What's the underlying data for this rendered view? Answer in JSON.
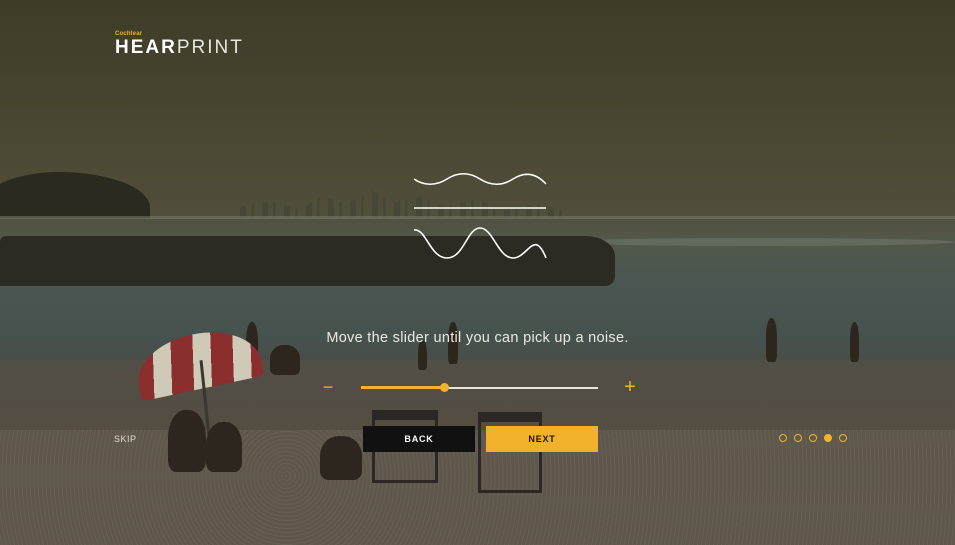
{
  "logo": {
    "brand": "Cochlear",
    "name_strong": "HEAR",
    "name_light": "PRINT"
  },
  "instruction": "Move the slider until you can pick up a noise.",
  "slider": {
    "minus_symbol": "−",
    "plus_symbol": "+",
    "value": 0.35
  },
  "skip_label": "SKIP",
  "buttons": {
    "back_label": "BACK",
    "next_label": "NEXT"
  },
  "pagination": {
    "total": 5,
    "active_index": 3
  },
  "colors": {
    "accent": "#f2b12b",
    "back_button": "#111111",
    "text": "#ffffff"
  }
}
